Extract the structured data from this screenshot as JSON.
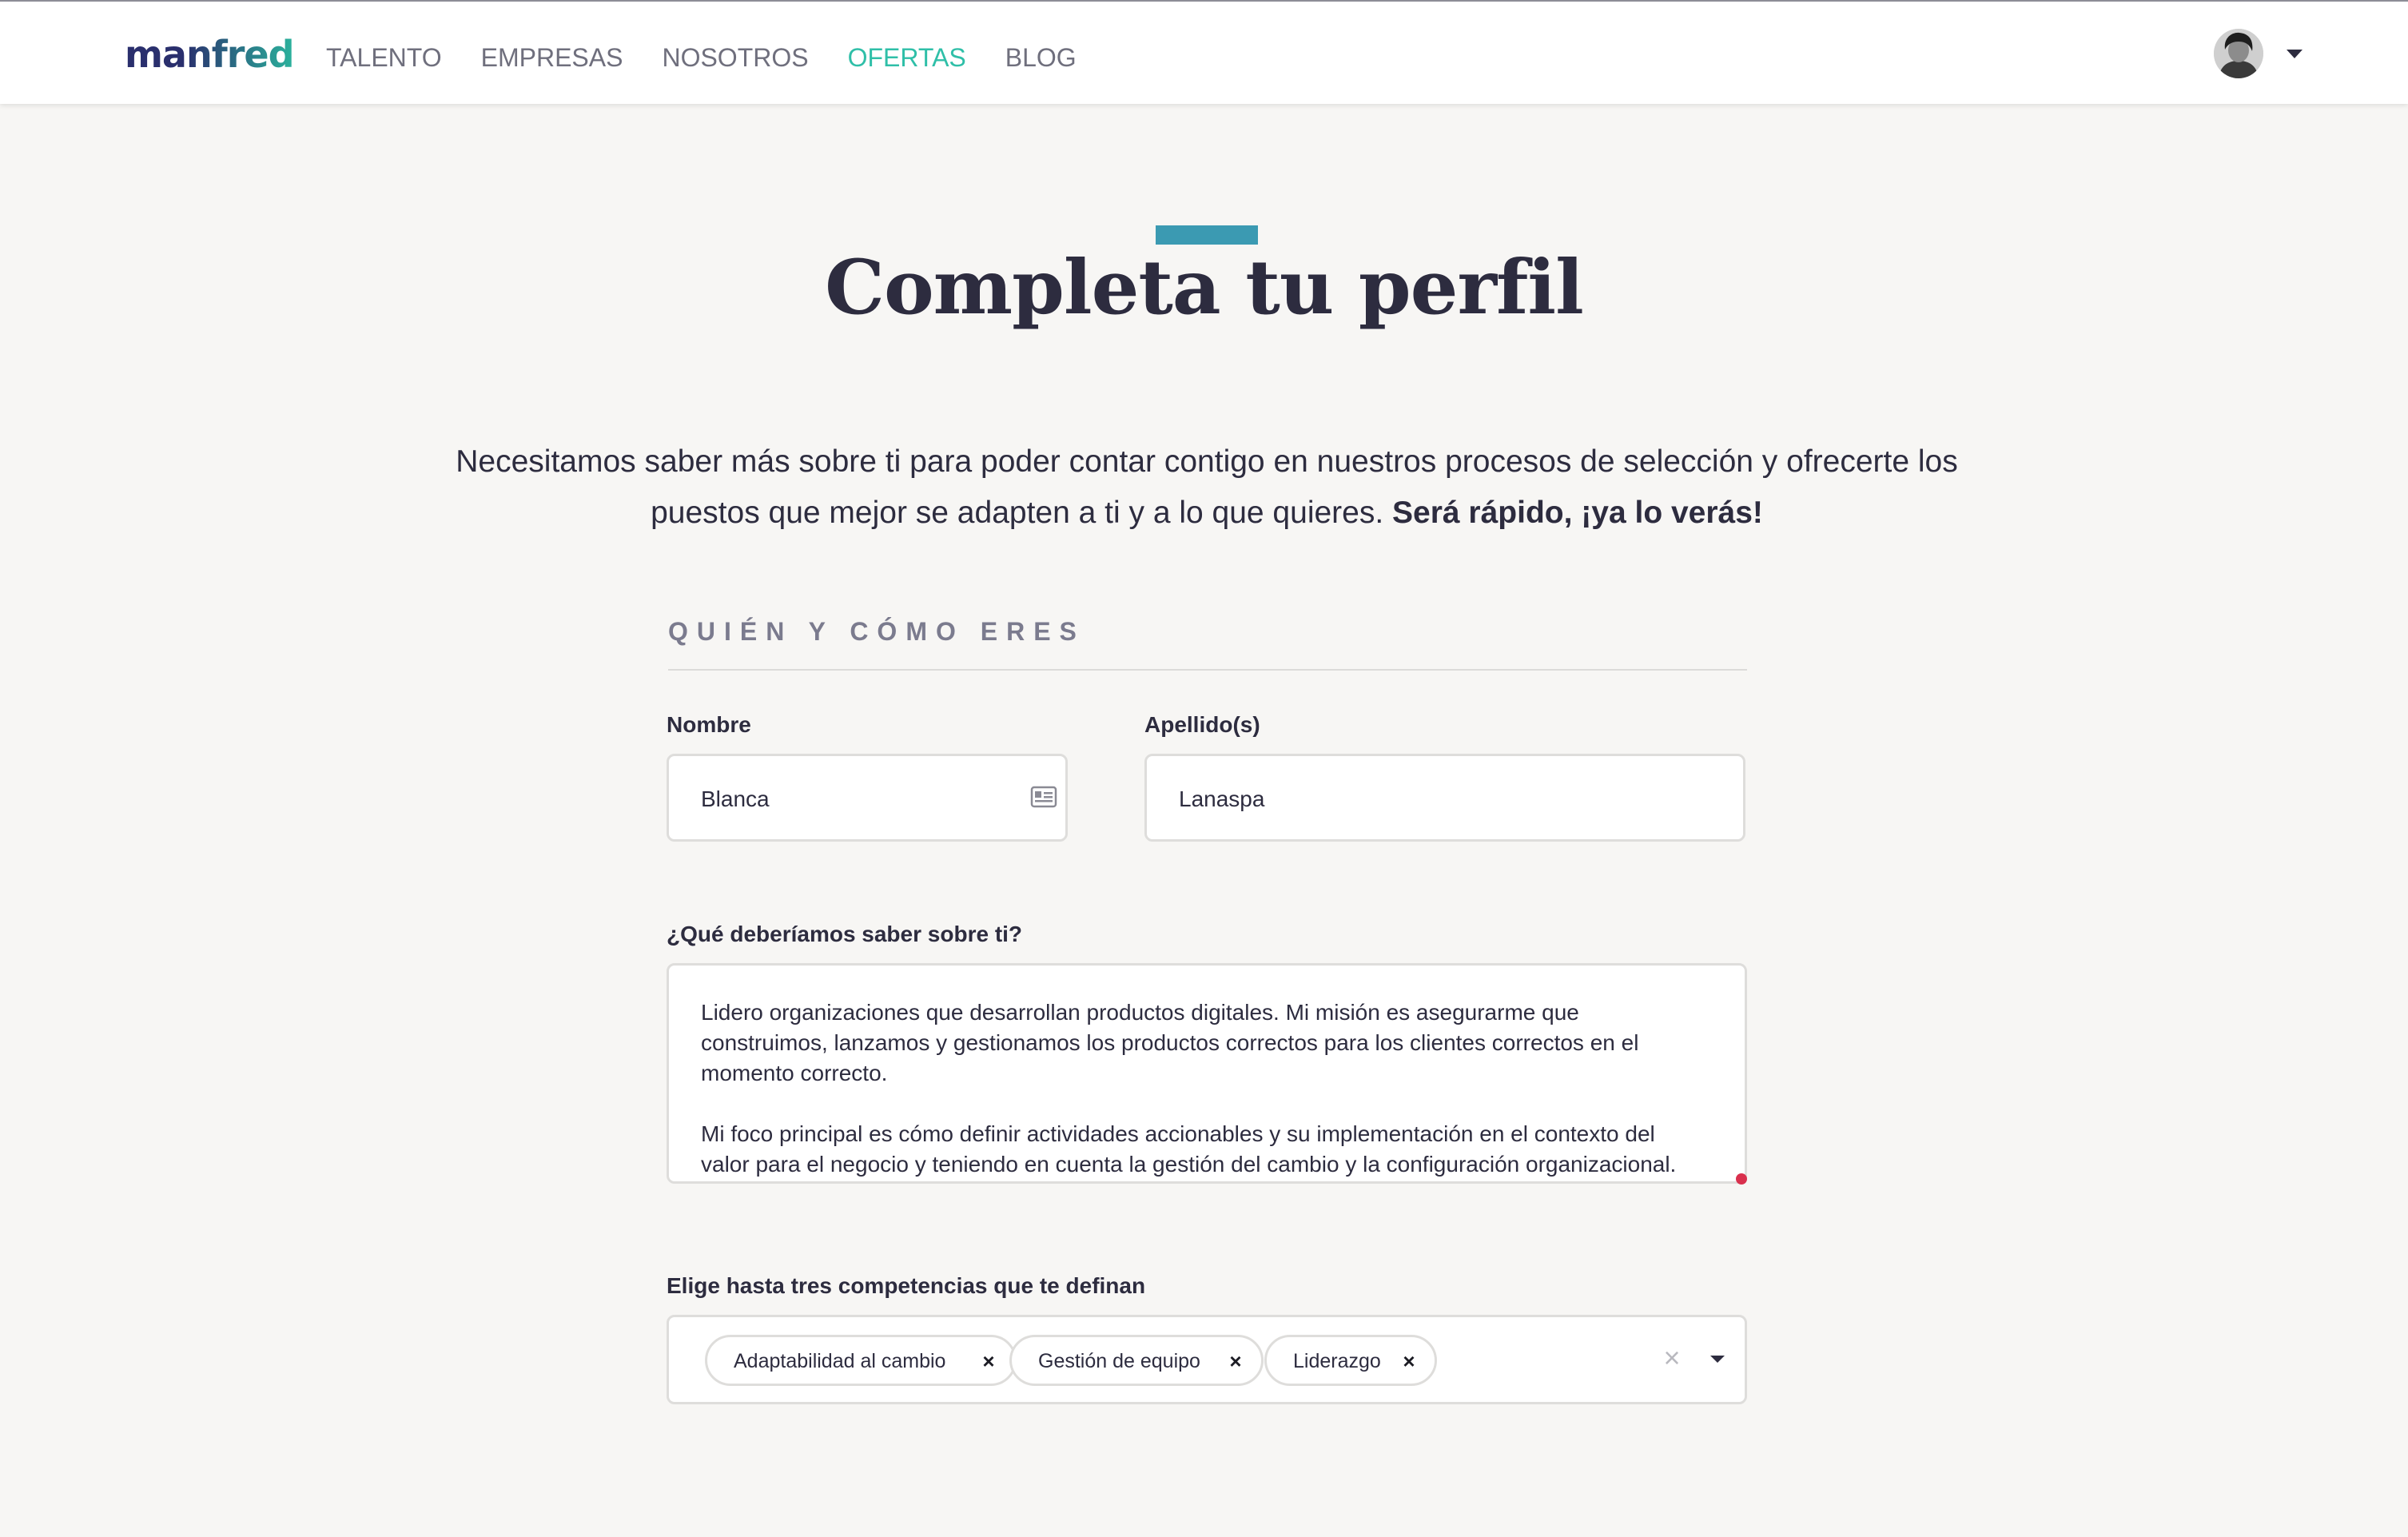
{
  "header": {
    "logo_text": "manfred",
    "nav": [
      {
        "label": "TALENTO",
        "active": false
      },
      {
        "label": "EMPRESAS",
        "active": false
      },
      {
        "label": "NOSOTROS",
        "active": false
      },
      {
        "label": "OFERTAS",
        "active": true
      },
      {
        "label": "BLOG",
        "active": false
      }
    ],
    "user_menu_icon": "chevron-down-icon"
  },
  "page": {
    "title": "Completa tu perfil",
    "intro_text": "Necesitamos saber más sobre ti para poder contar contigo en nuestros procesos de selección y ofrecerte los puestos que mejor se adapten a ti y a lo que quieres.",
    "intro_bold": "Será rápido, ¡ya lo verás!"
  },
  "form": {
    "section_title": "QUIÉN Y CÓMO ERES",
    "first_name": {
      "label": "Nombre",
      "value": "Blanca",
      "icon": "id-card-icon"
    },
    "last_name": {
      "label": "Apellido(s)",
      "value": "Lanaspa"
    },
    "about": {
      "label": "¿Qué deberíamos saber sobre ti?",
      "paragraph_1": "Lidero organizaciones que desarrollan productos digitales. Mi misión es asegurarme que construimos, lanzamos y gestionamos los productos correctos para los clientes correctos en el momento correcto.",
      "paragraph_2": "Mi foco principal es cómo definir actividades accionables y su implementación en el contexto del valor para el negocio y teniendo en cuenta la gestión del cambio y la configuración organizacional."
    },
    "competencies": {
      "label": "Elige hasta tres competencias que te definan",
      "selected": [
        {
          "label": "Adaptabilidad al cambio"
        },
        {
          "label": "Gestión de equipo"
        },
        {
          "label": "Liderazgo"
        }
      ],
      "remove_glyph": "×",
      "clear_glyph": "×"
    }
  },
  "colors": {
    "accent_teal": "#2fbfa8",
    "title_bar": "#3b9ab2",
    "text_dark": "#2d2c3f",
    "background": "#f7f6f4"
  }
}
